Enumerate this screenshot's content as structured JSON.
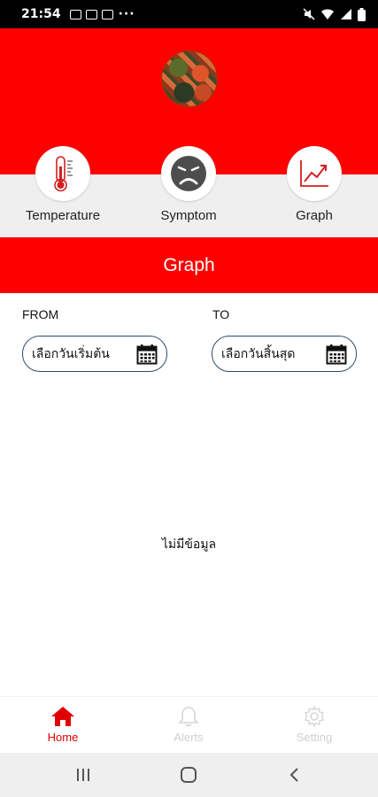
{
  "status_bar": {
    "time": "21:54",
    "dots": "···"
  },
  "menu": {
    "items": [
      {
        "label": "Temperature",
        "icon": "thermometer-icon"
      },
      {
        "label": "Symptom",
        "icon": "sad-face-icon"
      },
      {
        "label": "Graph",
        "icon": "line-chart-icon"
      }
    ]
  },
  "page": {
    "title": "Graph"
  },
  "date_range": {
    "from_label": "FROM",
    "to_label": "TO",
    "from_placeholder": "เลือกวันเริ่มต้น",
    "to_placeholder": "เลือกวันสิ้นสุด"
  },
  "content": {
    "empty_message": "ไม่มีข้อมูล"
  },
  "bottom_nav": {
    "items": [
      {
        "label": "Home",
        "active": true
      },
      {
        "label": "Alerts",
        "active": false
      },
      {
        "label": "Setting",
        "active": false
      }
    ]
  },
  "colors": {
    "primary": "#ff0000",
    "gray_band": "#efefef",
    "active_nav": "#e00000",
    "inactive_nav": "#cfcfcf",
    "input_border": "#2c4a6a"
  }
}
